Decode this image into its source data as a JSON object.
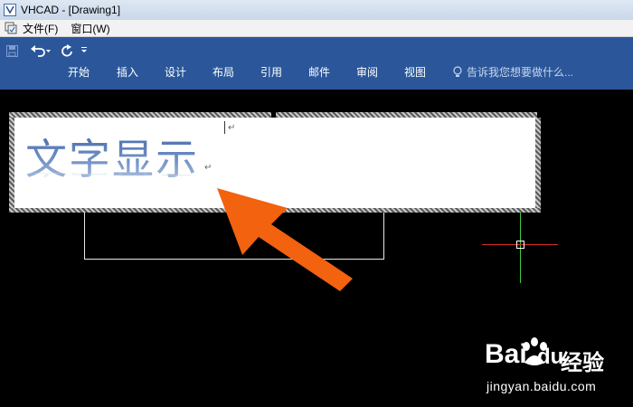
{
  "window": {
    "title": "VHCAD - [Drawing1]"
  },
  "menubar": {
    "items": [
      "文件(F)",
      "窗口(W)"
    ]
  },
  "quick_access": {
    "save_icon": "save-icon",
    "undo_icon": "undo-icon",
    "redo_icon": "redo-icon",
    "more_icon": "customize-dropdown-icon"
  },
  "ribbon": {
    "tabs": [
      "开始",
      "插入",
      "设计",
      "布局",
      "引用",
      "邮件",
      "审阅",
      "视图"
    ],
    "tell_me": "告诉我您想要做什么...",
    "background": "#2b579a"
  },
  "editor": {
    "text": "文字显示",
    "paragraph_mark": "↵"
  },
  "crosshair": {
    "vertical_color": "#3ccb3c",
    "horizontal_color": "#d9302c"
  },
  "annotation": {
    "arrow_color": "#f2620f"
  },
  "watermark": {
    "brand": "Bai",
    "brand_suffix": "du",
    "cn": "经验",
    "url": "jingyan.baidu.com"
  }
}
